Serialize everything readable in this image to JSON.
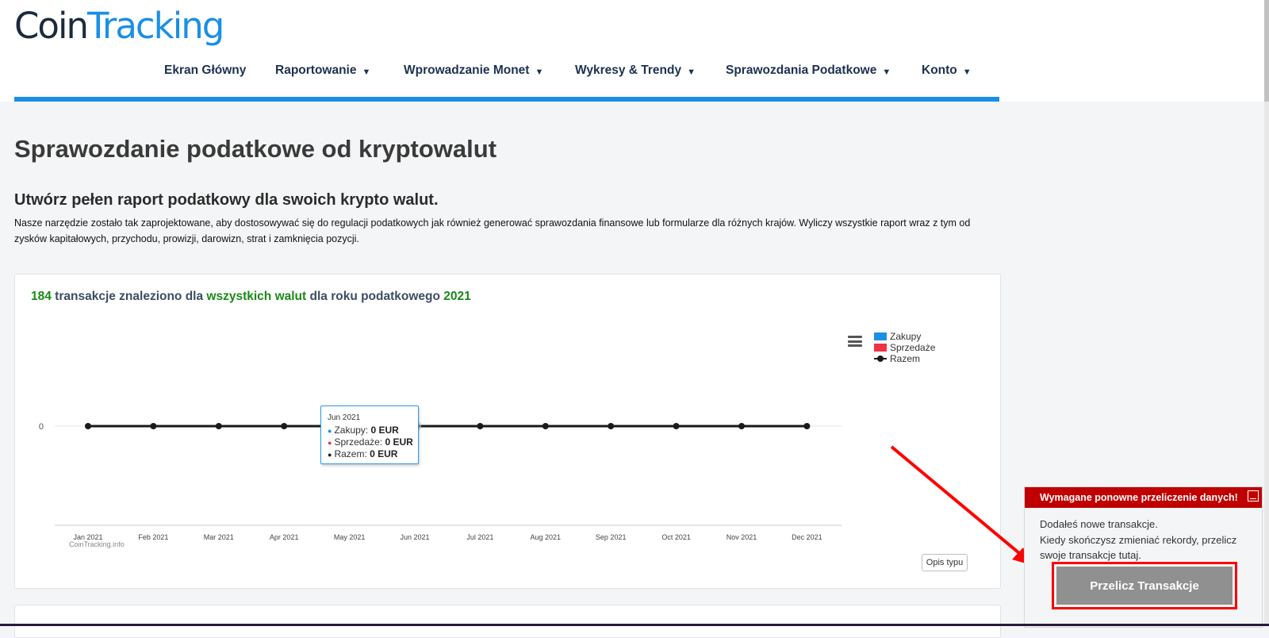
{
  "header": {
    "logo_part1": "Coin",
    "logo_part2": "Tracking",
    "nav": [
      {
        "label": "Ekran Główny",
        "dropdown": false
      },
      {
        "label": "Raportowanie",
        "dropdown": true
      },
      {
        "label": "Wprowadzanie Monet",
        "dropdown": true
      },
      {
        "label": "Wykresy & Trendy",
        "dropdown": true
      },
      {
        "label": "Sprawozdania Podatkowe",
        "dropdown": true
      },
      {
        "label": "Konto",
        "dropdown": true
      }
    ],
    "caret": "▼"
  },
  "page": {
    "title": "Sprawozdanie podatkowe od kryptowalut",
    "subtitle": "Utwórz pełen raport podatkowy dla swoich krypto walut.",
    "description": "Nasze narzędzie zostało tak zaprojektowane, aby dostosowywać się do regulacji podatkowych jak również generować sprawozdania finansowe lub formularze dla różnych krajów. Wyliczy wszystkie raport wraz z tym od zysków kapitałowych, przychodu, prowizji, darowizn, strat i zamknięcia pozycji."
  },
  "summary": {
    "count": "184",
    "text1": " transakcje znaleziono dla ",
    "scope": "wszystkich walut",
    "text2": " dla roku podatkowego ",
    "year": "2021"
  },
  "colors": {
    "purchases": "#1a8fe6",
    "sales": "#ee3344",
    "total": "#1a1a1a",
    "accent": "#1a8fe6",
    "alert": "#c00000"
  },
  "chart_data": {
    "type": "line",
    "x": [
      "Jan 2021",
      "Feb 2021",
      "Mar 2021",
      "Apr 2021",
      "May 2021",
      "Jun 2021",
      "Jul 2021",
      "Aug 2021",
      "Sep 2021",
      "Oct 2021",
      "Nov 2021",
      "Dec 2021"
    ],
    "series": [
      {
        "name": "Zakupy",
        "type": "bar",
        "values": [
          0,
          0,
          0,
          0,
          0,
          0,
          0,
          0,
          0,
          0,
          0,
          0
        ]
      },
      {
        "name": "Sprzedaże",
        "type": "bar",
        "values": [
          0,
          0,
          0,
          0,
          0,
          0,
          0,
          0,
          0,
          0,
          0,
          0
        ]
      },
      {
        "name": "Razem",
        "type": "line",
        "values": [
          0,
          0,
          0,
          0,
          0,
          0,
          0,
          0,
          0,
          0,
          0,
          0
        ]
      }
    ],
    "y_ticks": [
      "0"
    ],
    "legend_position": "top-right",
    "credit": "CoinTracking.info",
    "hovered_index": 5,
    "tooltip": {
      "title": "Jun 2021",
      "rows": [
        {
          "label": "Zakupy: ",
          "value": "0 EUR"
        },
        {
          "label": "Sprzedaże: ",
          "value": "0 EUR"
        },
        {
          "label": "Razem: ",
          "value": "0 EUR"
        }
      ]
    }
  },
  "buttons": {
    "opis": "Opis typu",
    "menu_icon": "hamburger-icon"
  },
  "notification": {
    "title": "Wymagane ponowne przeliczenie danych!",
    "line1": "Dodałeś nowe transakcje.",
    "line2": "Kiedy skończysz zmieniać rekordy, przelicz swoje transakcje tutaj.",
    "button": "Przelicz Transakcje"
  }
}
